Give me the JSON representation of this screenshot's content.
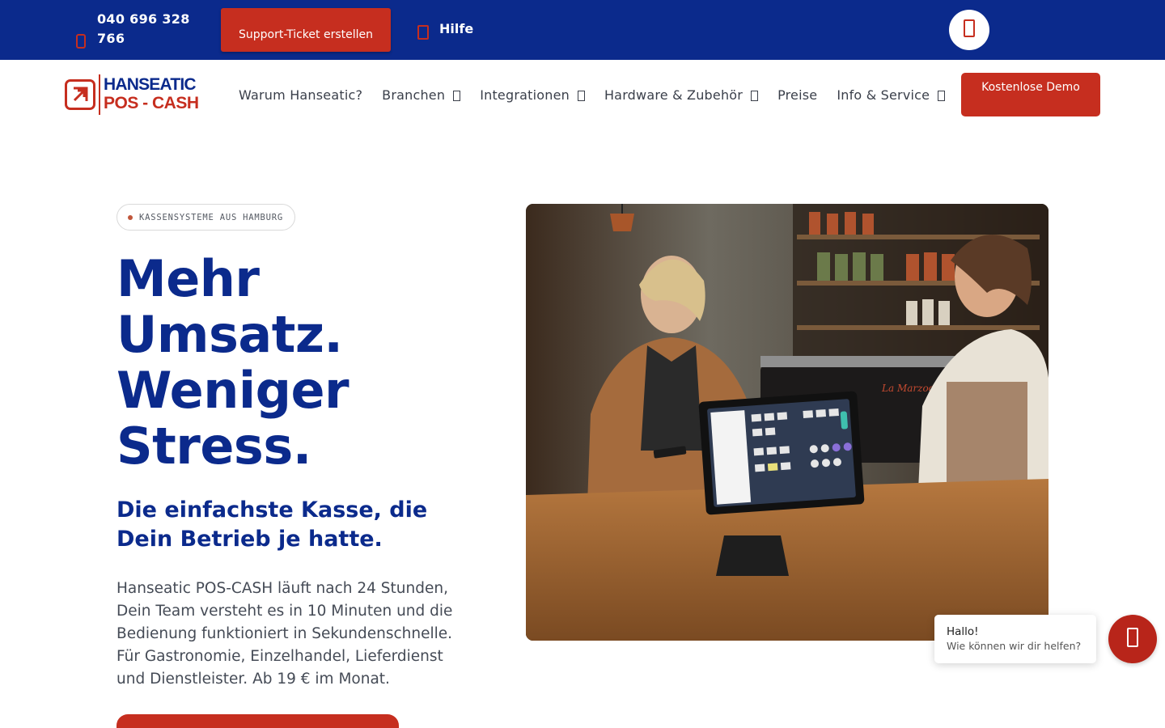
{
  "topbar": {
    "phone": "040 696 328 766",
    "ticket_label": "Support-Ticket erstellen",
    "help_label": "Hilfe",
    "phone_icon": "phone-icon",
    "help_icon": "help-icon",
    "profile_icon": "user-icon"
  },
  "header": {
    "logo_line1": "HANSEATIC",
    "logo_line2": "POS - CASH",
    "nav": [
      {
        "label": "Warum Hanseatic?"
      },
      {
        "label": "Branchen"
      },
      {
        "label": "Integrationen"
      },
      {
        "label": "Hardware & Zubehör"
      },
      {
        "label": "Preise"
      },
      {
        "label": "Info & Service"
      }
    ],
    "demo_label": "Kostenlose Demo"
  },
  "hero": {
    "eyebrow": "KASSENSYSTEME AUS HAMBURG",
    "title": "Mehr Umsatz. Weniger Stress.",
    "subtitle": "Die einfachste Kasse, die Dein Betrieb je hatte.",
    "body": "Hanseatic POS-CASH läuft nach 24 Stunden, Dein Team versteht es in 10 Minuten und die Bedienung funktioniert in Sekundenschnelle. Für Gastronomie, Einzelhandel, Lieferdienst und Dienstleister. Ab 19 € im Monat."
  },
  "chat": {
    "greeting": "Hallo!",
    "message": "Wie können wir dir helfen?",
    "chat_icon": "chat-icon"
  },
  "colors": {
    "brand_blue": "#0b2a8c",
    "brand_red": "#c62e1f"
  }
}
